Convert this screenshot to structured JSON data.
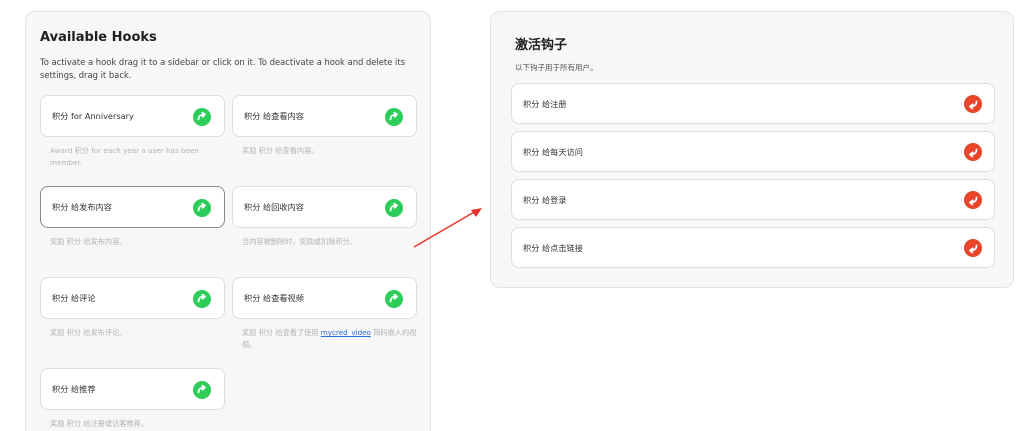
{
  "available": {
    "title": "Available Hooks",
    "description": "To activate a hook drag it to a sidebar or click on it. To deactivate a hook and delete its settings, drag it back.",
    "hooks": [
      {
        "label": "积分 for Anniversary",
        "desc": "Award 积分 for each year a user has been member."
      },
      {
        "label": "积分 给查看内容",
        "desc": "奖励 积分 给查看内容。"
      },
      {
        "label": "积分 给发布内容",
        "desc": "奖励 积分 给发布内容。"
      },
      {
        "label": "积分 给回收内容",
        "desc": "当内容被删除时，奖励或扣除积分。"
      },
      {
        "label": "积分 给评论",
        "desc": "奖励 积分 给发布评论。"
      },
      {
        "label": "积分 给查看视频",
        "desc_before": "奖励 积分 给查看了使用 ",
        "desc_link": "mycred_video",
        "desc_after": " 简码嵌入的视频。"
      },
      {
        "label": "积分 给推荐",
        "desc": "奖励 积分 给注册或访客推荐。"
      }
    ]
  },
  "active": {
    "title": "激活钩子",
    "description": "以下钩子用于所有用户。",
    "hooks": [
      {
        "label": "积分 给注册"
      },
      {
        "label": "积分 给每天访问"
      },
      {
        "label": "积分 给登录"
      },
      {
        "label": "积分 给点击链接"
      }
    ]
  },
  "colors": {
    "activate_icon": "#2ecc58",
    "deactivate_icon": "#e8452c",
    "arrow": "#e8302a",
    "link": "#2d6bd6"
  },
  "icons": {
    "activate": "arrow-forward-circle-icon",
    "deactivate": "arrow-back-circle-icon",
    "annotation": "drag-direction-arrow"
  }
}
